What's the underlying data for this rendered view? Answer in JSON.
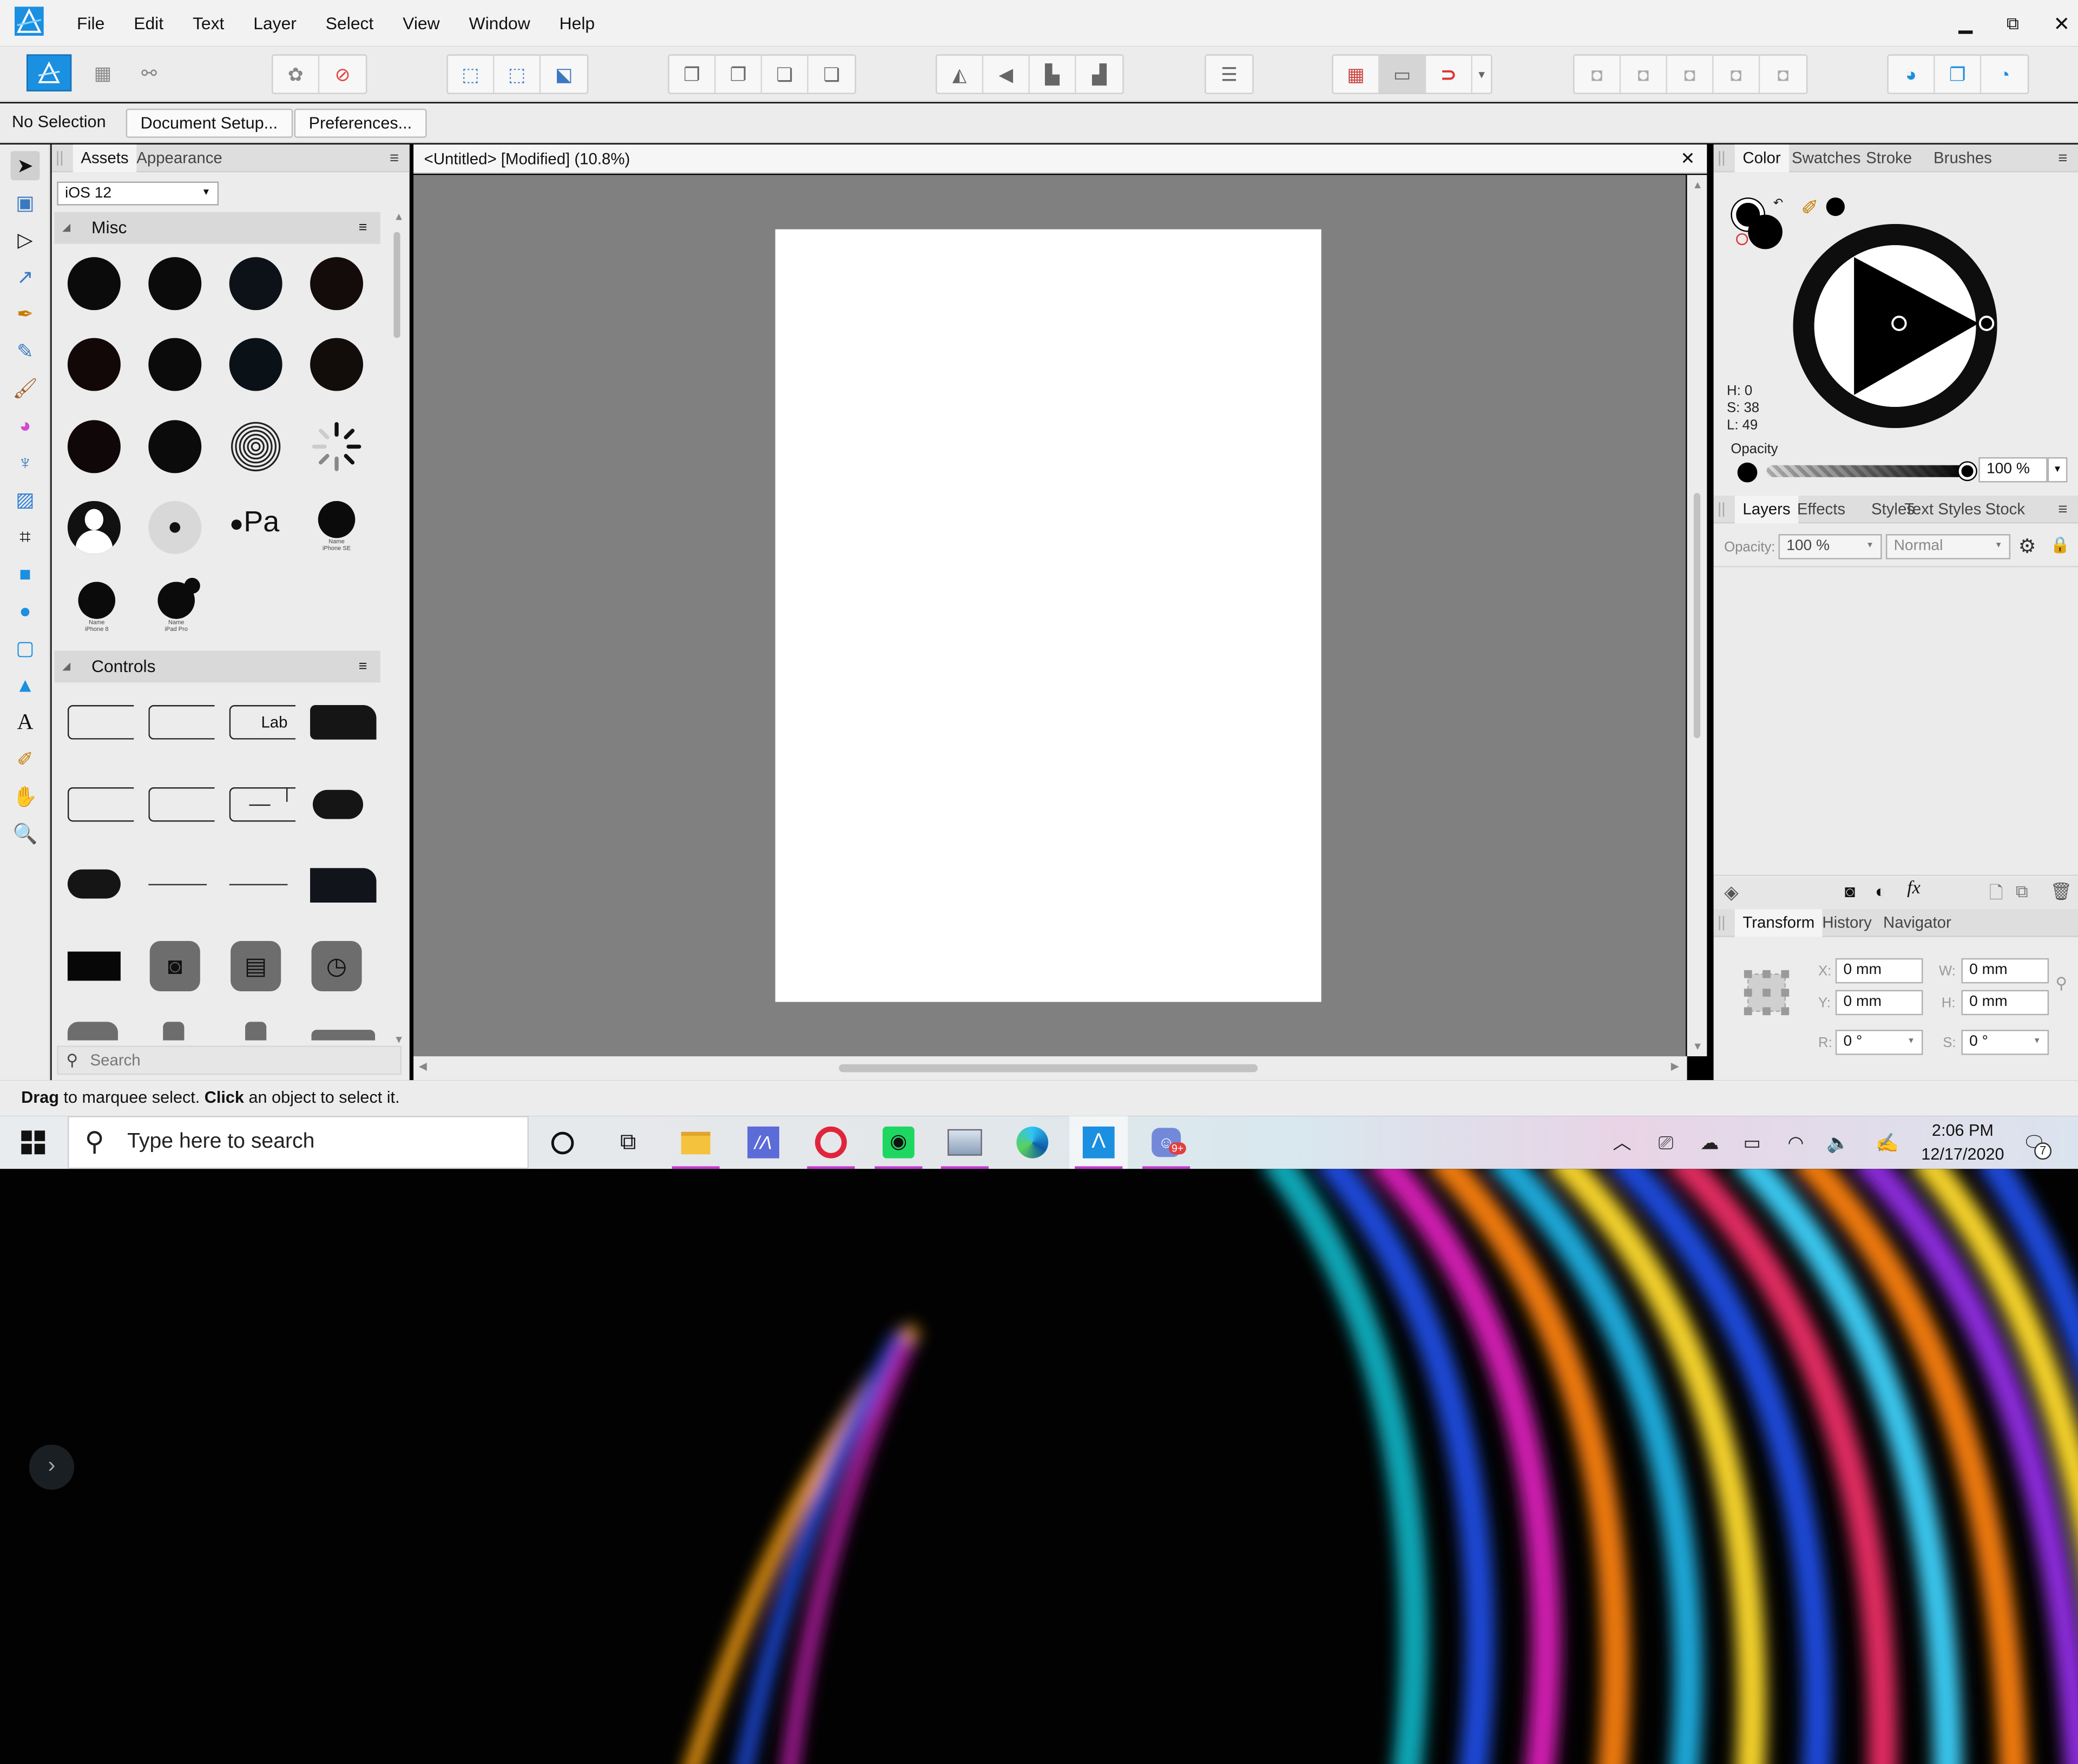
{
  "menubar": {
    "items": [
      "File",
      "Edit",
      "Text",
      "Layer",
      "Select",
      "View",
      "Window",
      "Help"
    ],
    "window_controls": [
      "minimize",
      "restore",
      "close"
    ]
  },
  "context": {
    "selection": "No Selection",
    "document_setup": "Document Setup...",
    "preferences": "Preferences..."
  },
  "assets": {
    "tabs": [
      "Assets",
      "Appearance"
    ],
    "library": "iOS 12",
    "sections": [
      {
        "title": "Misc"
      },
      {
        "title": "Controls"
      }
    ],
    "misc_captions": [
      "Name",
      "iPhone SE",
      "Name",
      "iPhone 8",
      "Name",
      "iPad Pro"
    ],
    "label_text": "Lab",
    "applepay_text": "Pa",
    "search_placeholder": "Search"
  },
  "document": {
    "tab_title": "<Untitled> [Modified] (10.8%)"
  },
  "color_panel": {
    "tabs": [
      "Color",
      "Swatches",
      "Stroke",
      "Brushes"
    ],
    "h": "H: 0",
    "s": "S: 38",
    "l": "L: 49",
    "opacity_label": "Opacity",
    "opacity_value": "100 %"
  },
  "layers_panel": {
    "tabs": [
      "Layers",
      "Effects",
      "Styles",
      "Text Styles",
      "Stock"
    ],
    "opacity_label": "Opacity:",
    "opacity_value": "100 %",
    "blend_mode": "Normal"
  },
  "transform_panel": {
    "tabs": [
      "Transform",
      "History",
      "Navigator"
    ],
    "x_label": "X:",
    "x_value": "0 mm",
    "y_label": "Y:",
    "y_value": "0 mm",
    "w_label": "W:",
    "w_value": "0 mm",
    "h_label": "H:",
    "h_value": "0 mm",
    "r_label": "R:",
    "r_value": "0 °",
    "s_label": "S:",
    "s_value": "0 °"
  },
  "status": {
    "drag": "Drag",
    "drag_text": " to marquee select. ",
    "click": "Click",
    "click_text": " an object to select it."
  },
  "taskbar": {
    "search_placeholder": "Type here to search",
    "time": "2:06 PM",
    "date": "12/17/2020",
    "discord_badge": "9+",
    "notification_count": "7"
  },
  "colors": {
    "accent": "#1e88e5",
    "affinity_blue": "#1b8fe0",
    "canvas_gray": "#808080"
  }
}
